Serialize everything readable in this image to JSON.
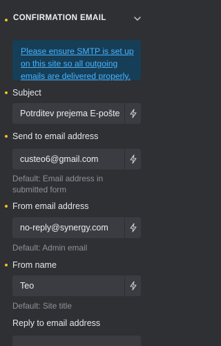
{
  "section": {
    "title": "CONFIRMATION EMAIL"
  },
  "notice": {
    "text": "Please ensure SMTP is set up on this site so all outgoing emails are delivered properly."
  },
  "fields": {
    "subject": {
      "label": "Subject",
      "value": "Potrditev prejema E-pošte"
    },
    "send_to": {
      "label": "Send to email address",
      "value": "custeo6@gmail.com",
      "hint": "Default: Email address in submitted form"
    },
    "from_email": {
      "label": "From email address",
      "value": "no-reply@synergy.com",
      "hint": "Default: Admin email"
    },
    "from_name": {
      "label": "From name",
      "value": "Teo",
      "hint": "Default: Site title"
    },
    "reply_to": {
      "label": "Reply to email address"
    }
  },
  "icons": {
    "dynamic": "lightning-bolt-icon",
    "collapse": "chevron-down-icon",
    "required": "dot-icon"
  },
  "colors": {
    "background": "#2e3034",
    "input": "#3a3c41",
    "accent_dot": "#f0c419",
    "notice_bg": "#173e57",
    "notice_link": "#47b3ff"
  }
}
